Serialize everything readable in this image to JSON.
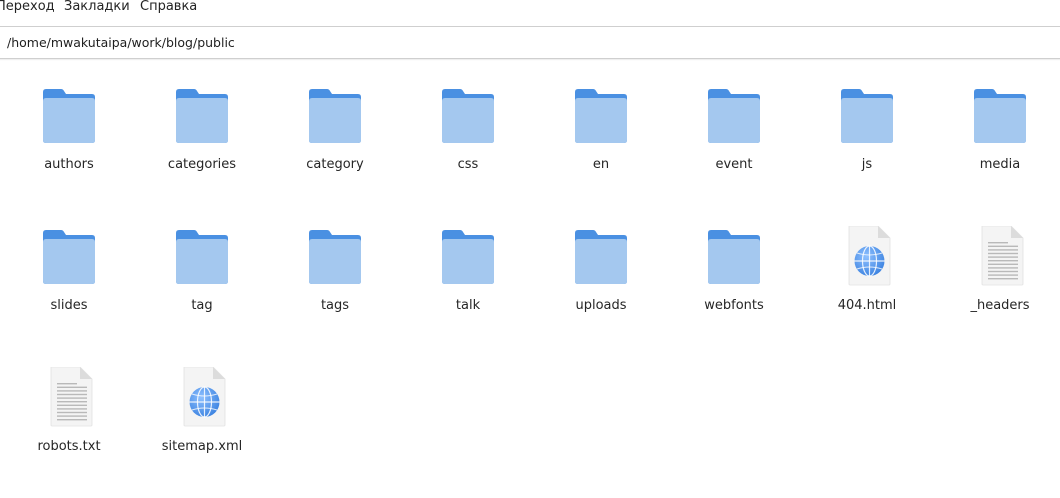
{
  "menu": {
    "items": [
      {
        "label": "Переход"
      },
      {
        "label": "Закладки"
      },
      {
        "label": "Справка"
      }
    ]
  },
  "location": {
    "path": "/home/mwakutaipa/work/blog/public"
  },
  "files": [
    {
      "name": "authors",
      "type": "folder"
    },
    {
      "name": "categories",
      "type": "folder"
    },
    {
      "name": "category",
      "type": "folder"
    },
    {
      "name": "css",
      "type": "folder"
    },
    {
      "name": "en",
      "type": "folder"
    },
    {
      "name": "event",
      "type": "folder"
    },
    {
      "name": "js",
      "type": "folder"
    },
    {
      "name": "media",
      "type": "folder"
    },
    {
      "name": "slides",
      "type": "folder"
    },
    {
      "name": "tag",
      "type": "folder"
    },
    {
      "name": "tags",
      "type": "folder"
    },
    {
      "name": "talk",
      "type": "folder"
    },
    {
      "name": "uploads",
      "type": "folder"
    },
    {
      "name": "webfonts",
      "type": "folder"
    },
    {
      "name": "404.html",
      "type": "html"
    },
    {
      "name": "_headers",
      "type": "text"
    },
    {
      "name": "robots.txt",
      "type": "text"
    },
    {
      "name": "sitemap.xml",
      "type": "html"
    }
  ],
  "colors": {
    "folder_back": "#4a90e2",
    "folder_front": "#a4c8ef",
    "page": "#f4f4f4",
    "page_fold": "#dcdcdc",
    "text_lines": "#b9b9b9",
    "globe": "#3b82e0"
  }
}
